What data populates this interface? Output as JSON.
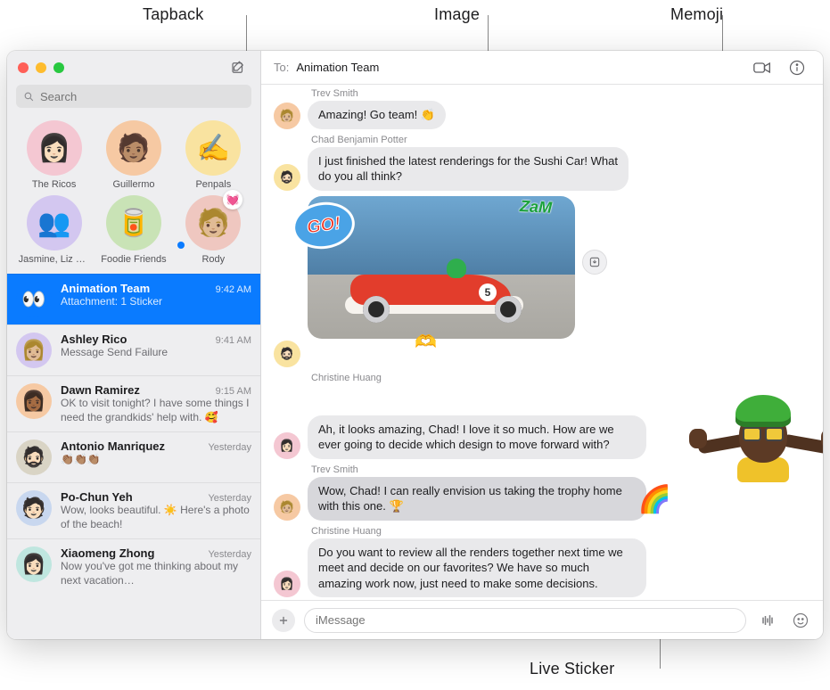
{
  "callouts": {
    "tapback": "Tapback",
    "image": "Image",
    "memoji": "Memoji",
    "live_sticker": "Live Sticker"
  },
  "sidebar": {
    "search_placeholder": "Search",
    "pinned": [
      {
        "label": "The Ricos"
      },
      {
        "label": "Guillermo"
      },
      {
        "label": "Penpals",
        "glyph": "✍️"
      },
      {
        "label": "Jasmine, Liz &…"
      },
      {
        "label": "Foodie Friends",
        "glyph": "🥫"
      },
      {
        "label": "Rody",
        "tapback": "💓",
        "unread": true
      }
    ],
    "conversations": [
      {
        "name": "Animation Team",
        "time": "9:42 AM",
        "sub": "Attachment: 1 Sticker",
        "glyph": "👀",
        "active": true
      },
      {
        "name": "Ashley Rico",
        "time": "9:41 AM",
        "sub": "Message Send Failure"
      },
      {
        "name": "Dawn Ramirez",
        "time": "9:15 AM",
        "sub": "OK to visit tonight? I have some things I need the grandkids' help with. 🥰"
      },
      {
        "name": "Antonio Manriquez",
        "time": "Yesterday",
        "sub": "👏🏽👏🏽👏🏽"
      },
      {
        "name": "Po-Chun Yeh",
        "time": "Yesterday",
        "sub": "Wow, looks beautiful. ☀️ Here's a photo of the beach!"
      },
      {
        "name": "Xiaomeng Zhong",
        "time": "Yesterday",
        "sub": "Now you've got me thinking about my next vacation…"
      }
    ]
  },
  "chat": {
    "to_label": "To:",
    "to_name": "Animation Team",
    "messages": {
      "m0_sender": "Trev Smith",
      "m0_text": "Amazing! Go team! 👏",
      "m1_sender": "Chad Benjamin Potter",
      "m1_text": "I just finished the latest renderings for the Sushi Car! What do you all think?",
      "image_number": "5",
      "go_label": "GO!",
      "zap_label": "ZaM",
      "heart_hands": "🫶",
      "m2_sender": "Christine Huang",
      "m2_text": "Ah, it looks amazing, Chad! I love it so much. How are we ever going to decide which design to move forward with?",
      "m3_sender": "Trev Smith",
      "m3_text": "Wow, Chad! I can really envision us taking the trophy home with this one. 🏆",
      "m4_sender": "Christine Huang",
      "m4_text": "Do you want to review all the renders together next time we meet and decide on our favorites? We have so much amazing work now, just need to make some decisions."
    },
    "input_placeholder": "iMessage",
    "rainbow": "🌈"
  }
}
